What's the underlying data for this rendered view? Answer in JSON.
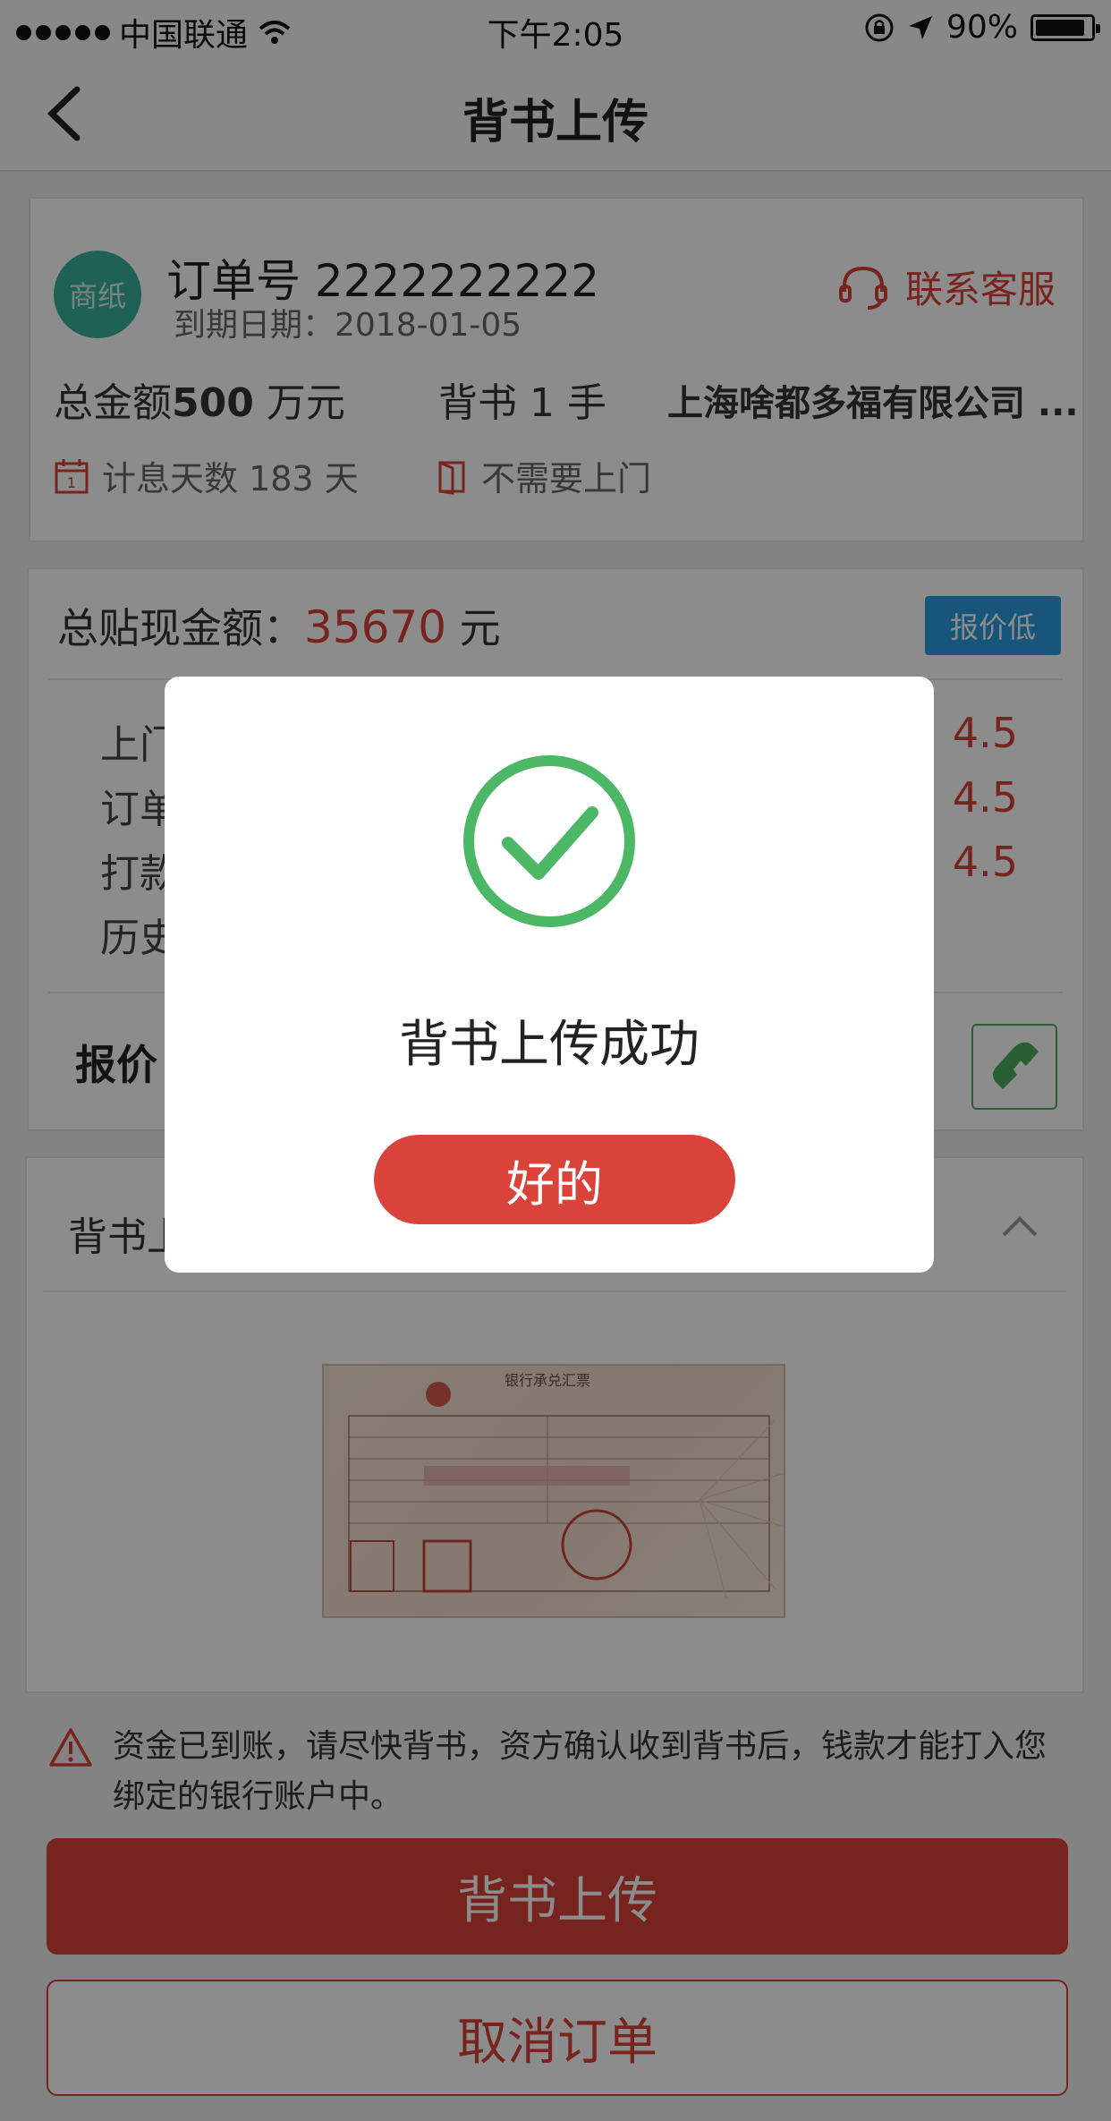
{
  "status_bar": {
    "carrier": "中国联通",
    "time": "下午2:05",
    "battery": "90%",
    "battery_level": 0.9
  },
  "nav": {
    "title": "背书上传"
  },
  "order": {
    "seal_text": "商纸",
    "order_no": "订单号 2222222222",
    "due_date": "到期日期：2018-01-05",
    "contact": "联系客服",
    "total_label": "总金额",
    "total_value": "500",
    "total_unit": " 万元",
    "endorse": "背书 1 手",
    "company": "上海啥都多福有限公司 ...",
    "interest_days": "计息天数 183 天",
    "visit": "不需要上门",
    "calendar_num": "1"
  },
  "discount": {
    "title_label": "总贴现金额：",
    "amount": "35670",
    "unit": " 元",
    "badge": "报价低",
    "rows": [
      {
        "label": "上门",
        "value": "4.5"
      },
      {
        "label": "订单",
        "value": "4.5"
      },
      {
        "label": "打款",
        "value": "4.5"
      },
      {
        "label": "历史",
        "value": ""
      }
    ],
    "quote_label": "报价"
  },
  "endorsement": {
    "title": "背书上",
    "bill_title": "银行承兑汇票"
  },
  "warning": "资金已到账，请尽快背书，资方确认收到背书后，钱款才能打入您绑定的银行账户中。",
  "buttons": {
    "upload": "背书上传",
    "cancel": "取消订单"
  },
  "dialog": {
    "message": "背书上传成功",
    "ok": "好的"
  },
  "colors": {
    "accent": "#d9433a",
    "success": "#4cb865",
    "badge": "#2a9be0",
    "seal": "#3bb19b"
  }
}
